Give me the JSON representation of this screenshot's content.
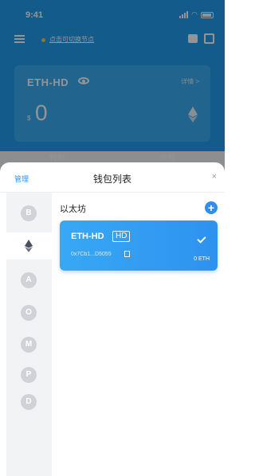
{
  "status": {
    "time": "9:41"
  },
  "topbar": {
    "node_hint": "点击可切换节点"
  },
  "wallet_card": {
    "name": "ETH-HD",
    "details_label": "详情 >",
    "currency_symbol": "$",
    "balance": "0"
  },
  "actions": {
    "transfer": "转账",
    "receive": "收款"
  },
  "sheet": {
    "manage_label": "管理",
    "title": "钱包列表",
    "close_label": "×",
    "chains": [
      {
        "name": "bitcoin",
        "icon": "B",
        "selected": false
      },
      {
        "name": "ethereum",
        "icon": "eth",
        "selected": true
      },
      {
        "name": "eos",
        "icon": "A",
        "selected": false
      },
      {
        "name": "chain-4",
        "icon": "O",
        "selected": false
      },
      {
        "name": "chain-5",
        "icon": "M",
        "selected": false
      },
      {
        "name": "chain-6",
        "icon": "P",
        "selected": false
      },
      {
        "name": "chain-7",
        "icon": "D",
        "selected": false
      }
    ],
    "chain_title": "以太坊",
    "add_label": "+",
    "wallets": [
      {
        "name": "ETH-HD",
        "badge": "HD",
        "address": "0x7Cb1...D5055",
        "balance": "0 ETH",
        "selected": true
      }
    ]
  },
  "colors": {
    "accent": "#2f8ff0",
    "header": "#1f9ef0"
  }
}
